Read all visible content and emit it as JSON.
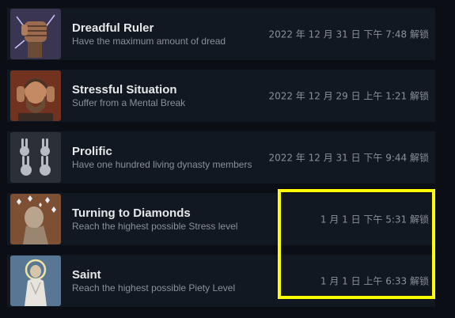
{
  "achievements": [
    {
      "title": "Dreadful Ruler",
      "description": "Have the maximum amount of dread",
      "unlocked": "2022 年 12 月 31 日 下午 7:48 解锁",
      "icon": "clenched-fist-icon"
    },
    {
      "title": "Stressful Situation",
      "description": "Suffer from a Mental Break",
      "unlocked": "2022 年 12 月 29 日 上午 1:21 解锁",
      "icon": "distressed-man-icon"
    },
    {
      "title": "Prolific",
      "description": "Have one hundred living dynasty members",
      "unlocked": "2022 年 12 月 31 日 下午 9:44 解锁",
      "icon": "rabbits-icon"
    },
    {
      "title": "Turning to Diamonds",
      "description": "Reach the highest possible Stress level",
      "unlocked": "1 月 1 日 下午 5:31 解锁",
      "icon": "diamond-statue-icon"
    },
    {
      "title": "Saint",
      "description": "Reach the highest possible Piety Level",
      "unlocked": "1 月 1 日 上午 6:33 解锁",
      "icon": "saint-icon"
    }
  ],
  "colors": {
    "highlight": "#ffff00",
    "row_bg": "#111821",
    "page_bg": "#0b0f15"
  }
}
